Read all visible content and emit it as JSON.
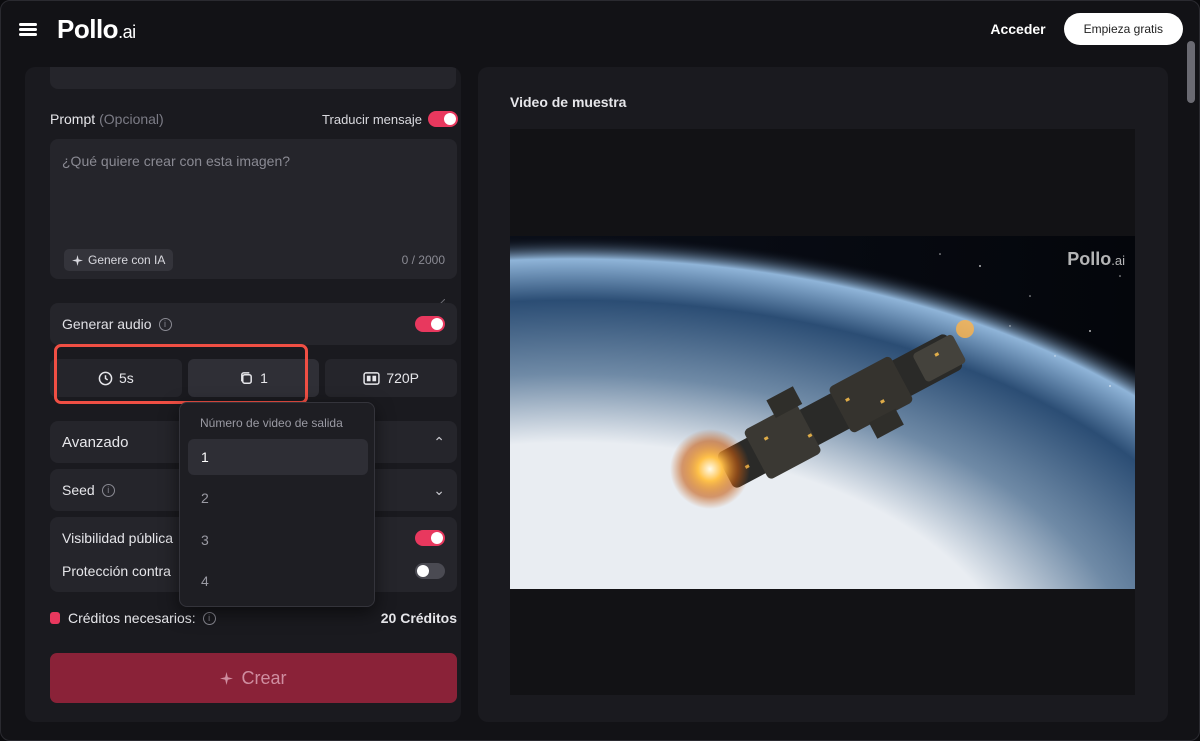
{
  "header": {
    "logo_main": "Pollo",
    "logo_suffix": ".ai",
    "login_label": "Acceder",
    "start_label": "Empieza gratis"
  },
  "prompt": {
    "label": "Prompt",
    "optional": "(Opcional)",
    "translate_label": "Traducir mensaje",
    "placeholder": "¿Qué quiere crear con esta imagen?",
    "ai_button": "Genere con IA",
    "char_count": "0 / 2000"
  },
  "audio": {
    "label": "Generar audio"
  },
  "options": {
    "duration": "5s",
    "count": "1",
    "resolution": "720P"
  },
  "dropdown": {
    "title": "Número de video de salida",
    "items": [
      "1",
      "2",
      "3",
      "4"
    ]
  },
  "advanced": {
    "label": "Avanzado"
  },
  "seed": {
    "label": "Seed"
  },
  "visibility": {
    "public_label": "Visibilidad pública",
    "protection_label": "Protección contra"
  },
  "credits": {
    "label": "Créditos necesarios:",
    "value": "20 Créditos"
  },
  "create": {
    "label": "Crear"
  },
  "sample": {
    "title": "Video de muestra",
    "watermark_main": "Pollo",
    "watermark_suffix": ".ai"
  },
  "colors": {
    "accent": "#e8385e",
    "create_bg": "#8a2238",
    "highlight": "#f04f44"
  }
}
